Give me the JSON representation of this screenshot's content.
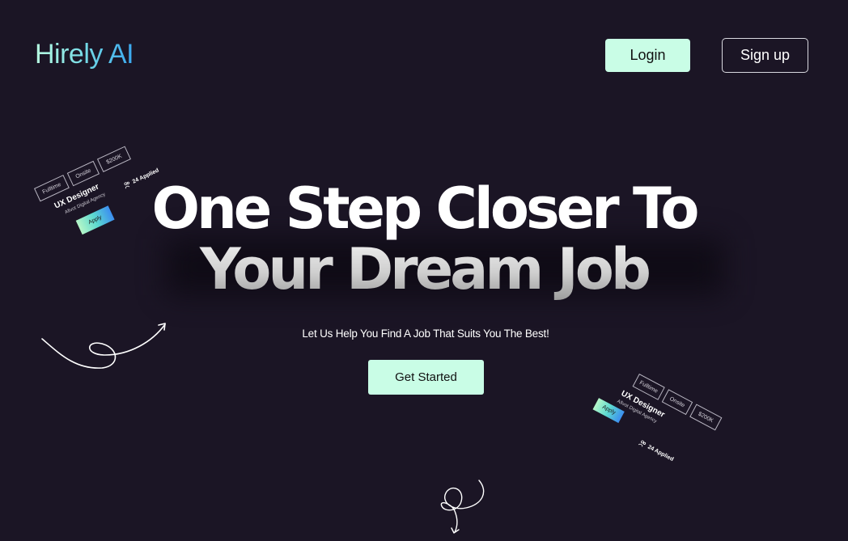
{
  "brand": {
    "logo_text": "Hirely AI"
  },
  "nav": {
    "login_label": "Login",
    "signup_label": "Sign up"
  },
  "hero": {
    "headline_line1": "One Step Closer To",
    "headline_line2": "Your Dream Job",
    "subtext": "Let Us Help You Find A Job That Suits You The Best!",
    "cta_label": "Get Started"
  },
  "job_cards": [
    {
      "tags": [
        "Fulltime",
        "Onsite",
        "$200K"
      ],
      "title": "UX Designer",
      "company": "Afivot Digital Agency",
      "apply_label": "Apply",
      "applied_text": "24 Applied"
    },
    {
      "tags": [
        "Fulltime",
        "Onsite",
        "$200K"
      ],
      "title": "UX Designer",
      "company": "Afivot Digital Agency",
      "apply_label": "Apply",
      "applied_text": "24 Applied"
    }
  ],
  "icons": {
    "applied_icon": "people-icon",
    "decor": [
      "swirl-arrow-icon",
      "loop-arrow-icon"
    ]
  },
  "colors": {
    "background": "#1b1525",
    "accent": "#c9fde6",
    "logo_gradient_start": "#b8fbe1",
    "logo_gradient_end": "#3aa7f0"
  }
}
